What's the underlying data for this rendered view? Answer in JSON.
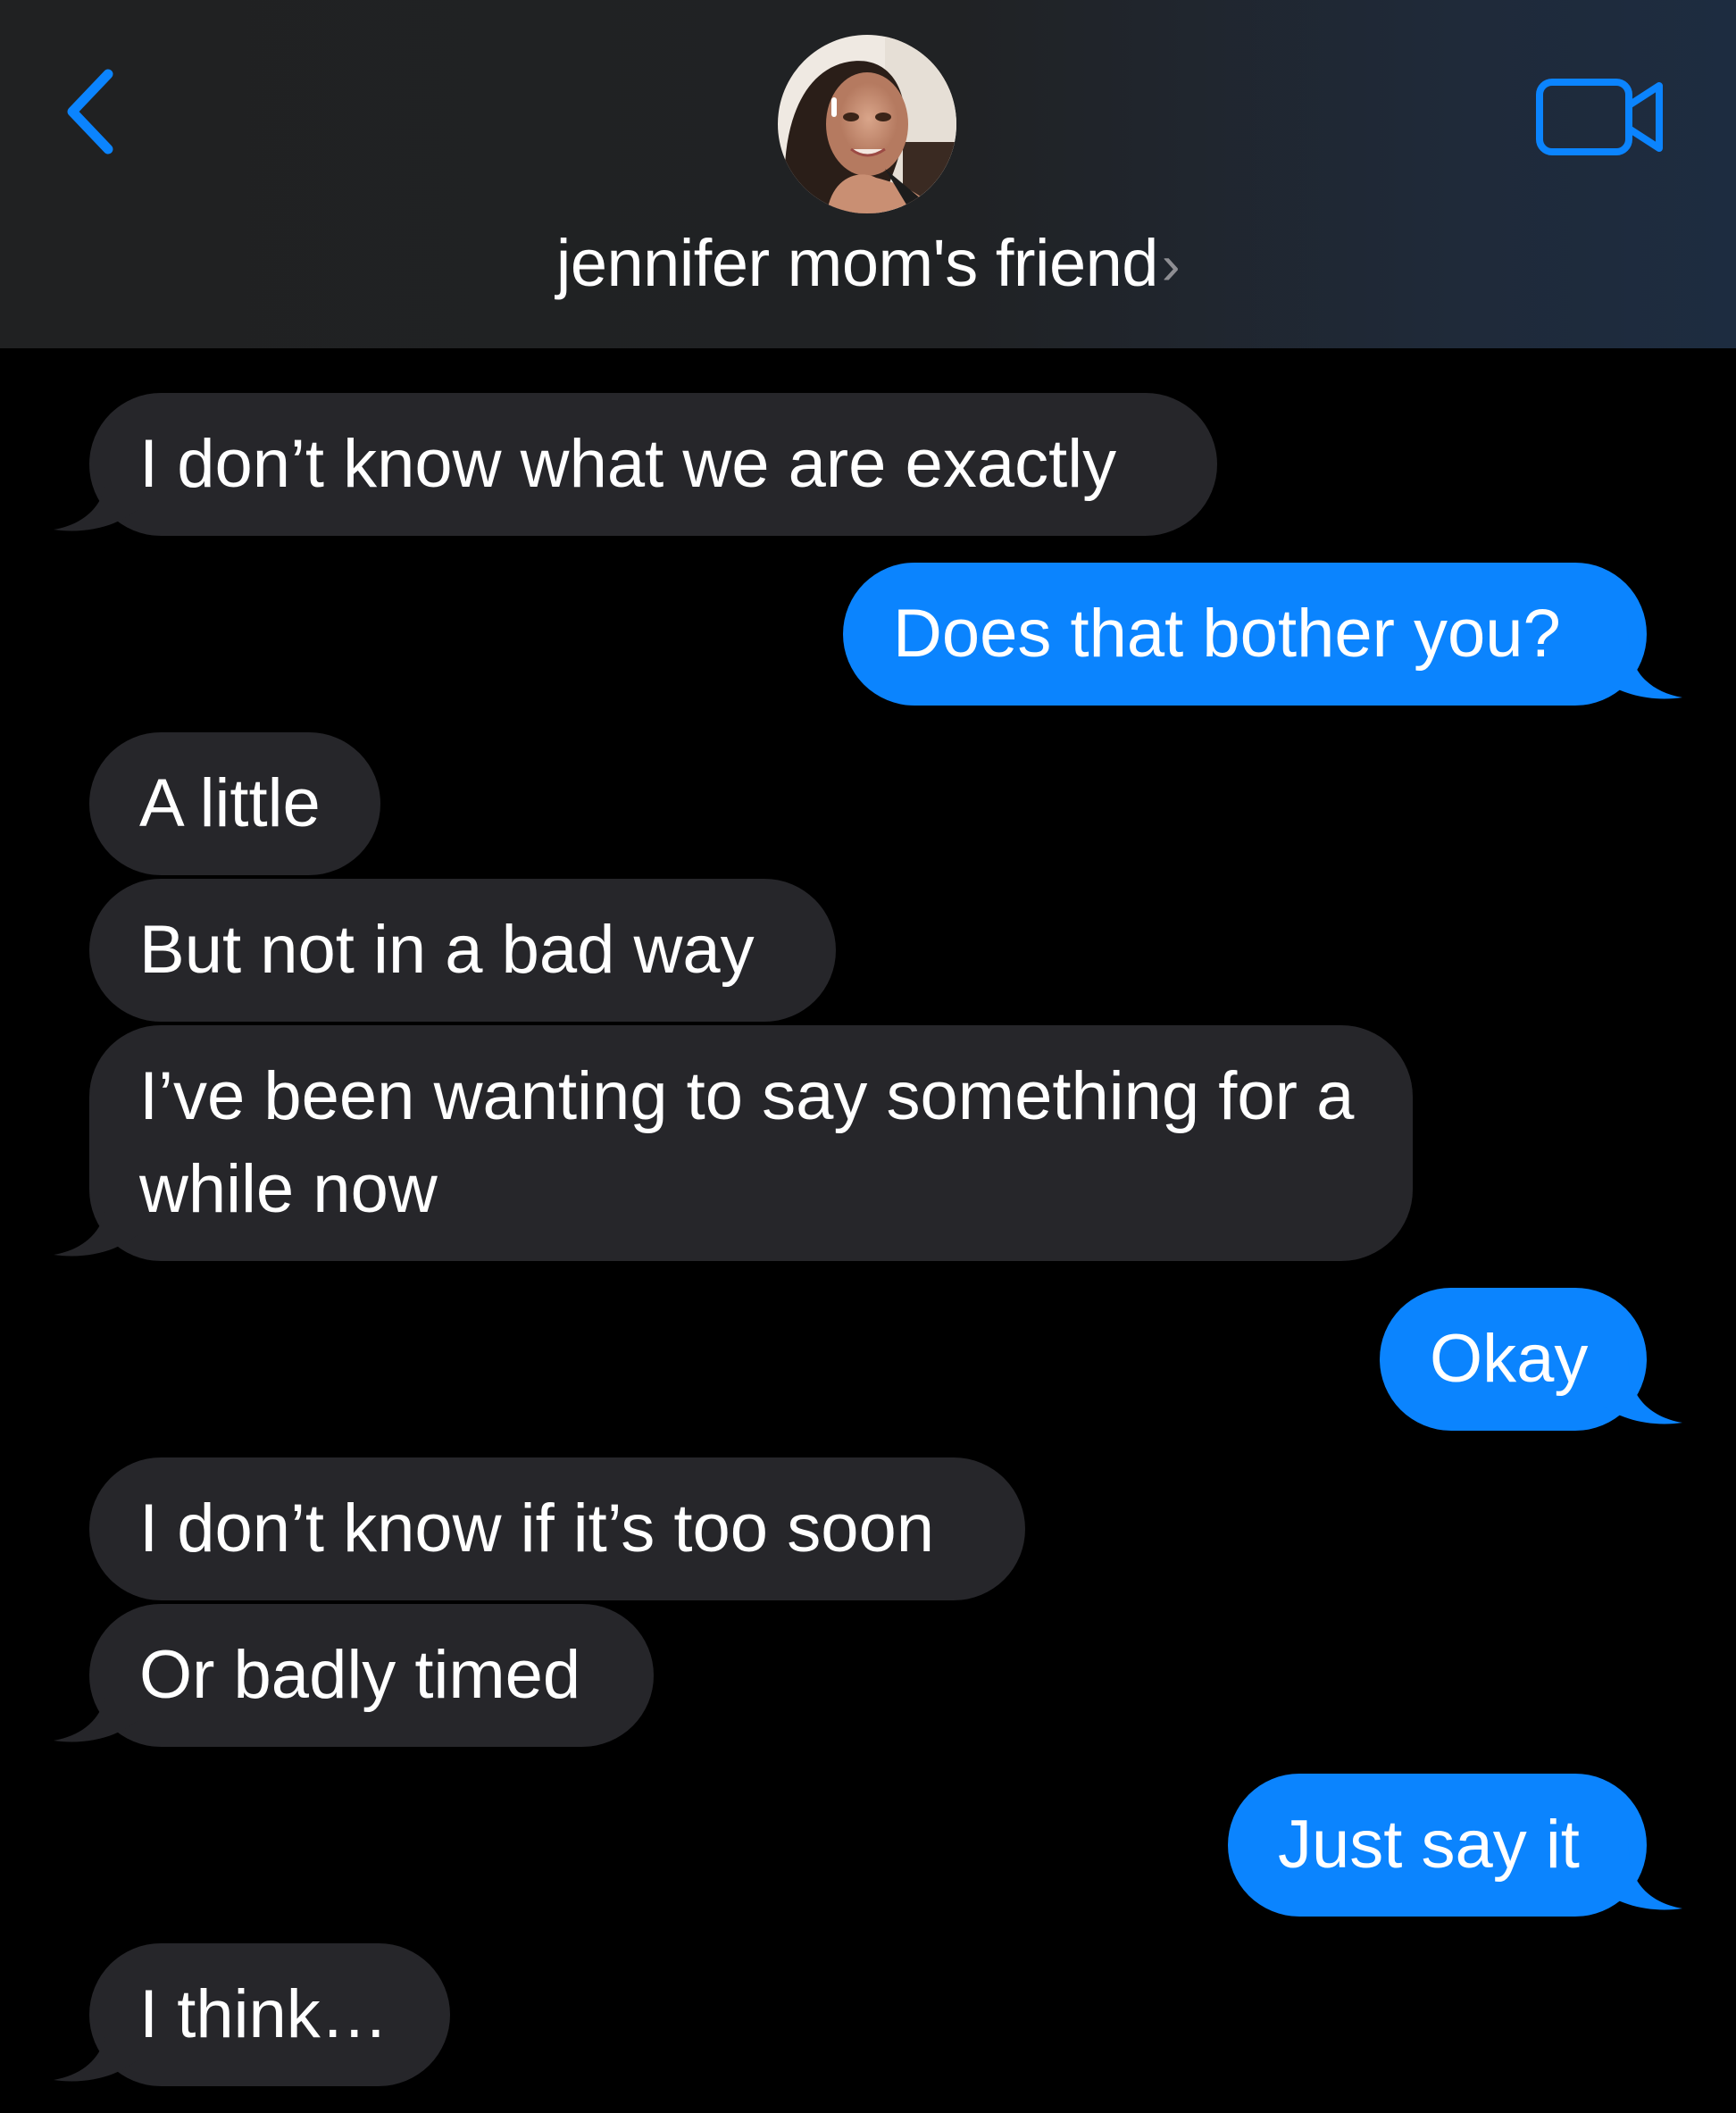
{
  "header": {
    "back_icon": "chevron-left-icon",
    "contact_name": "jennifer mom's friend",
    "contact_chevron": "›",
    "video_icon": "video-camera-icon",
    "accent_color": "#0b84fe"
  },
  "messages": [
    {
      "direction": "incoming",
      "text": "I don’t know what we are exactly",
      "tail": true
    },
    {
      "direction": "outgoing",
      "text": "Does that bother you?",
      "tail": true
    },
    {
      "direction": "incoming",
      "text": "A little",
      "tail": false
    },
    {
      "direction": "incoming",
      "text": "But not in a bad way",
      "tail": false
    },
    {
      "direction": "incoming",
      "text": "I’ve been wanting to say something for a while now",
      "tail": true
    },
    {
      "direction": "outgoing",
      "text": "Okay",
      "tail": true
    },
    {
      "direction": "incoming",
      "text": "I don’t know if it’s too soon",
      "tail": false
    },
    {
      "direction": "incoming",
      "text": "Or badly timed",
      "tail": true
    },
    {
      "direction": "outgoing",
      "text": "Just say it",
      "tail": true
    },
    {
      "direction": "incoming",
      "text": "I think…",
      "tail": true
    }
  ],
  "colors": {
    "incoming_bubble": "#26262a",
    "outgoing_bubble": "#0b84fe",
    "background": "#000000"
  }
}
